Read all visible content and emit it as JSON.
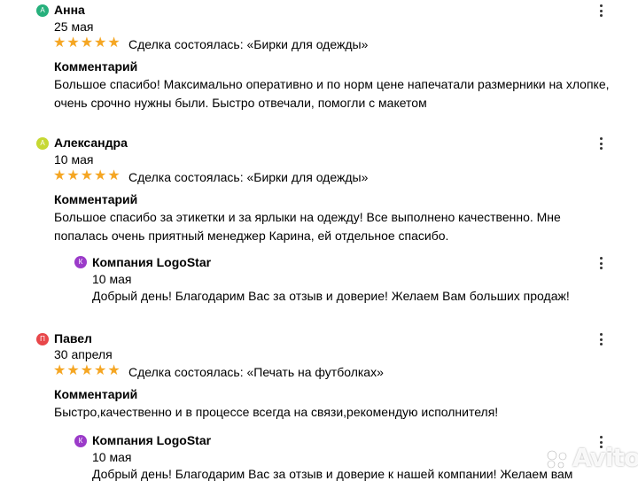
{
  "reviews": [
    {
      "avatar_letter": "А",
      "avatar_color": "#26b07c",
      "name": "Анна",
      "date": "25 мая",
      "rating": 5,
      "deal": "Сделка состоялась: «Бирки для одежды»",
      "comment_title": "Комментарий",
      "comment_lines": [
        "Большое спасибо! Максимально оперативно и по норм цене напечатали размерники на хлопке,",
        "очень срочно нужны были. Быстро отвечали, помогли с макетом"
      ]
    },
    {
      "avatar_letter": "А",
      "avatar_color": "#c6d832",
      "name": "Александра",
      "date": "10 мая",
      "rating": 5,
      "deal": "Сделка состоялась: «Бирки для одежды»",
      "comment_title": "Комментарий",
      "comment_lines": [
        "Большое спасибо за этикетки и за ярлыки на одежду! Все выполнено качественно. Мне",
        "попалась очень приятный менеджер Карина, ей отдельное спасибо."
      ],
      "reply": {
        "avatar_letter": "К",
        "avatar_color": "#9b3bc9",
        "name": "Компания LogoStar",
        "date": "10 мая",
        "text": "Добрый день! Благодарим Вас за отзыв и доверие! Желаем Вам больших продаж!"
      }
    },
    {
      "avatar_letter": "П",
      "avatar_color": "#e8474a",
      "name": "Павел",
      "date": "30 апреля",
      "rating": 5,
      "deal": "Сделка состоялась: «Печать на футболках»",
      "comment_title": "Комментарий",
      "comment_lines": [
        "Быстро,качественно и в процессе всегда на связи,рекомендую исполнителя!"
      ],
      "reply": {
        "avatar_letter": "К",
        "avatar_color": "#9b3bc9",
        "name": "Компания LogoStar",
        "date": "10 мая",
        "text": "Добрый день! Благодарим Вас за отзыв и доверие к нашей компании! Желаем вам"
      }
    }
  ],
  "watermark": "Avito",
  "star_color": "#f5a623"
}
